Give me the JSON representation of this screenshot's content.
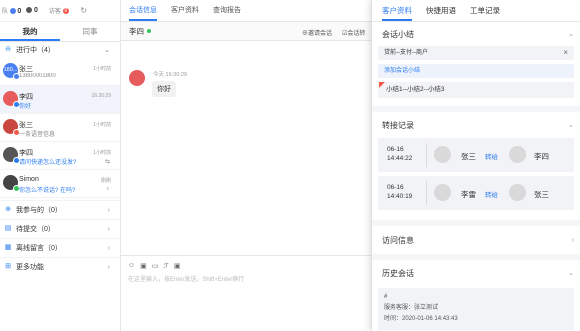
{
  "left": {
    "stats": [
      {
        "label": "队",
        "value": "0"
      },
      {
        "label": "",
        "value": "0"
      },
      {
        "label": "访客",
        "value": "0"
      }
    ],
    "tabs": [
      "我的",
      "同事"
    ],
    "group_active": "进行中（4）",
    "conversations": [
      {
        "name": "张三",
        "sub": "13800001800",
        "time": "1小时前",
        "avatar_text": "180...",
        "avatar_color": "#4a7ff2",
        "badge": "#4a7ff2",
        "sub_blue": false,
        "ext": ""
      },
      {
        "name": "李四",
        "sub": "你好",
        "time": "16:30:29",
        "avatar_text": "",
        "avatar_color": "#e65b5b",
        "badge": "#2d7cf2",
        "sub_blue": true,
        "ext": ""
      },
      {
        "name": "张三",
        "sub": "一条语音信息",
        "time": "1小时前",
        "avatar_text": "",
        "avatar_color": "#c9473e",
        "badge": "#f5564a",
        "sub_blue": false,
        "ext": ""
      },
      {
        "name": "李四",
        "sub": "请问快递怎么还没发?",
        "time": "1小时前",
        "avatar_text": "",
        "avatar_color": "#555555",
        "badge": "#2d7cf2",
        "sub_blue": true,
        "ext": "⇆"
      },
      {
        "name": "Simon",
        "sub": "你怎么不说话? 在吗?",
        "time": "刚刚",
        "avatar_text": "",
        "avatar_color": "#444444",
        "badge": "#35c35a",
        "sub_blue": true,
        "ext": "♁"
      }
    ],
    "nav": [
      {
        "label": "我参与的（0）",
        "icon": "⊕"
      },
      {
        "label": "待提交（0）",
        "icon": "▤"
      },
      {
        "label": "离线留言（0）",
        "icon": "▦"
      },
      {
        "label": "更多功能",
        "icon": "⊞"
      }
    ]
  },
  "mid": {
    "tabs": [
      "会话信息",
      "客户资料",
      "查询报告"
    ],
    "chat_with": "李四",
    "actions": [
      "⊕邀请会话",
      "☑会话转"
    ],
    "message": {
      "time": "今天 16:30:29",
      "text": "你好"
    },
    "tools": [
      "☺",
      "▣",
      "▭",
      "ℱ",
      "▣"
    ],
    "placeholder": "在这里输入，按Enter发送，Shift+Enter换行"
  },
  "right": {
    "tabs": [
      "客户资料",
      "快捷用语",
      "工单记录"
    ],
    "summary_title": "会话小结",
    "summary_tag": "贷前--支付--商户",
    "add_summary": "添加会话小结",
    "summary_line": "小结1--小结2--小结3",
    "transfer_title": "转接记录",
    "transfers": [
      {
        "date": "06-16",
        "time": "14:44:22",
        "from": "张三",
        "action": "转给",
        "to": "李四"
      },
      {
        "date": "06-16",
        "time": "14:40:19",
        "from": "李雷",
        "action": "转给",
        "to": "张三"
      }
    ],
    "visit_title": "访问信息",
    "history_title": "历史会话",
    "history": {
      "hash": "#",
      "agent": "服务客服：张立测试",
      "time": "时间：2020-01-06 14:43:43"
    }
  }
}
